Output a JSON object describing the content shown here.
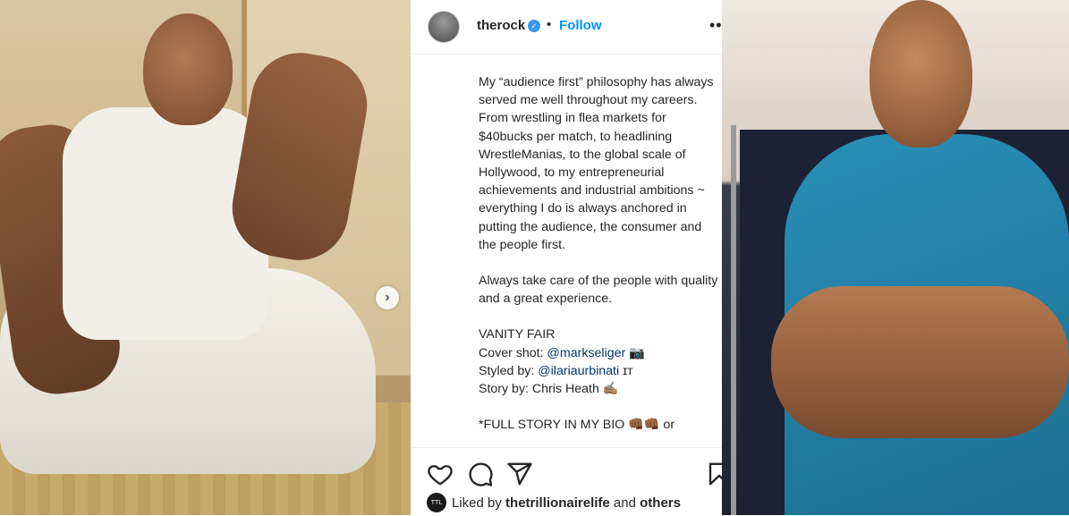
{
  "left_image": {
    "next_label": "›"
  },
  "post": {
    "username": "therock",
    "verified_glyph": "✓",
    "separator": "•",
    "follow_label": "Follow",
    "more_label": "•••",
    "caption": {
      "para1": "My “audience first” philosophy has always served me well throughout my careers.",
      "para2": "From wrestling in flea markets for $40bucks per match, to headlining WrestleManias, to the global scale of Hollywood, to my entrepreneurial achievements and industrial ambitions ~ everything I do is always anchored in putting the audience, the consumer and the people first.",
      "para3": "Always take care of the people with quality and a great experience.",
      "vanity": "VANITY FAIR",
      "cover_prefix": "Cover shot: ",
      "cover_mention": "@markseliger",
      "cover_emoji": "📷",
      "styled_prefix": "Styled by: ",
      "styled_mention": "@ilariaurbinati",
      "styled_suffix": "ɪᴛ",
      "story": "Story by: Chris Heath ✍🏽",
      "full_story": "*FULL STORY IN MY BIO 👊🏾👊🏾 or"
    },
    "actions": [
      "like-icon",
      "comment-icon",
      "share-icon",
      "save-icon"
    ],
    "liked": {
      "avatar_text": "TTL",
      "prefix": "Liked by ",
      "user": "thetrillionairelife",
      "middle": " and ",
      "others": "others"
    }
  }
}
